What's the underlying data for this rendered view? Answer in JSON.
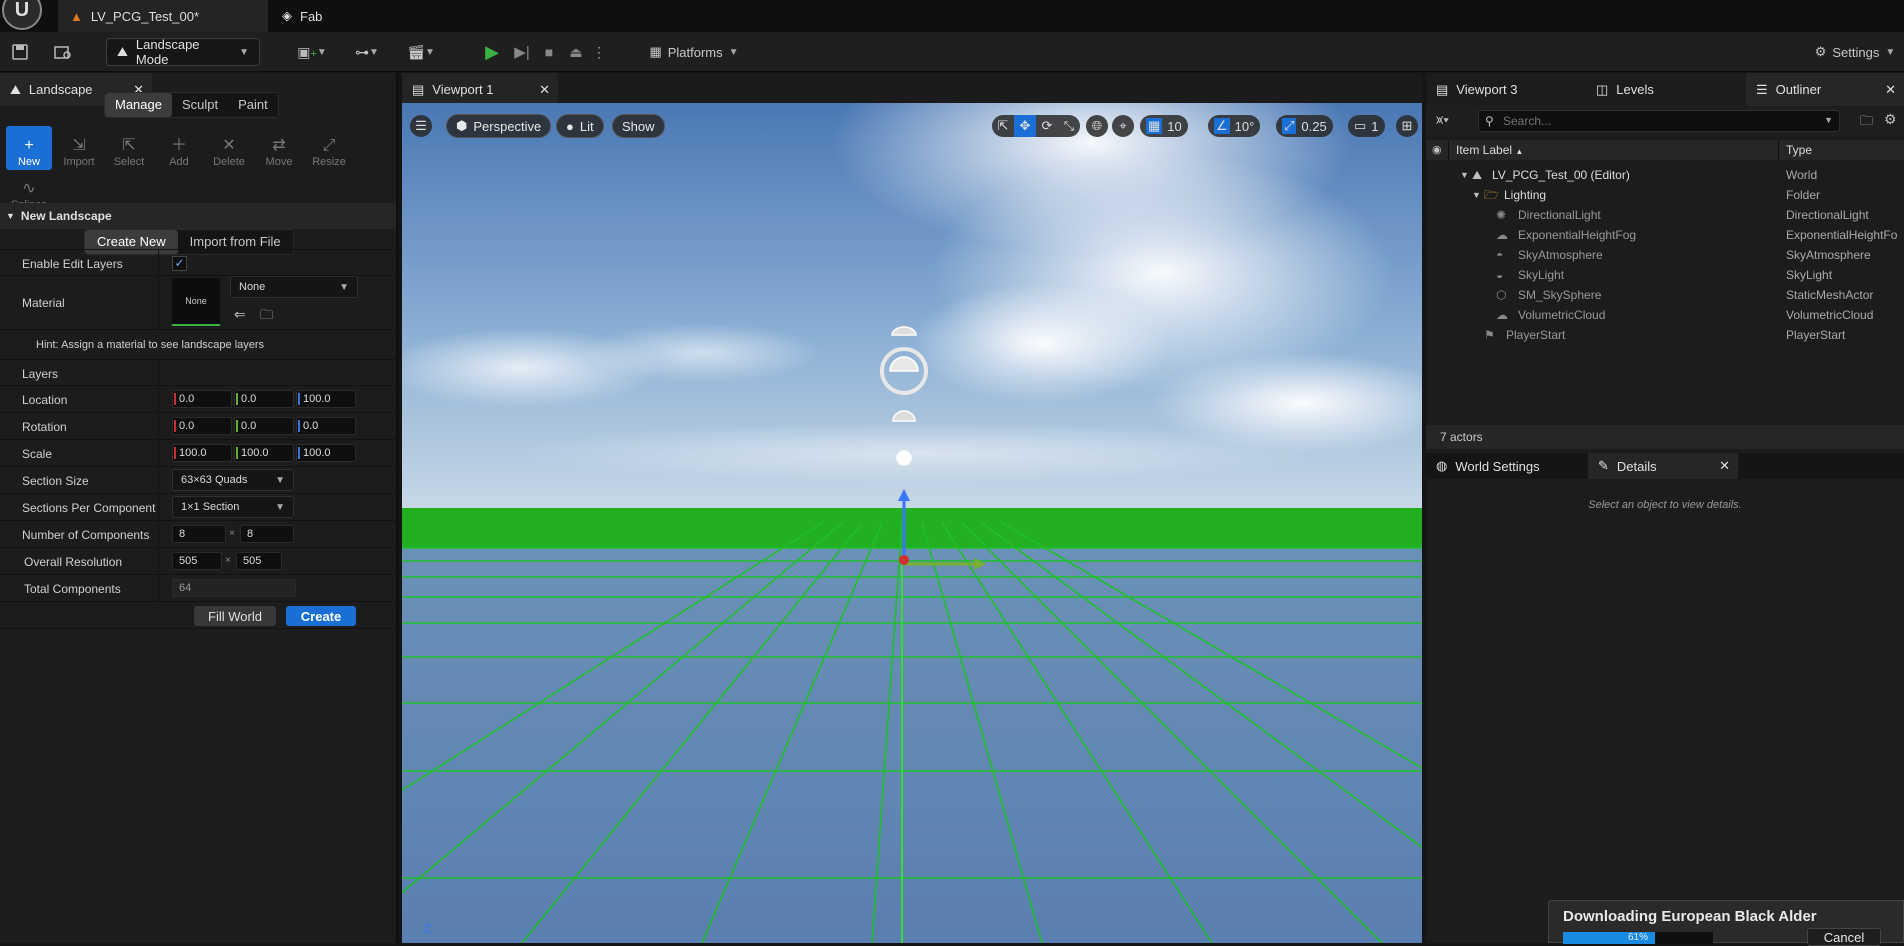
{
  "tabs": [
    {
      "label": "LV_PCG_Test_00*",
      "icon": "level-icon"
    },
    {
      "label": "Fab",
      "icon": "fab-icon"
    }
  ],
  "toolbar": {
    "mode_label": "Landscape Mode",
    "platforms_label": "Platforms",
    "settings_label": "Settings"
  },
  "landscape_panel": {
    "tab_label": "Landscape",
    "modes": [
      "Manage",
      "Sculpt",
      "Paint"
    ],
    "active_mode": "Manage",
    "tools": [
      "New",
      "Import",
      "Select",
      "Add",
      "Delete",
      "Move",
      "Resize",
      "Splines"
    ],
    "active_tool": "New",
    "section_title": "New Landscape",
    "source_tabs": [
      "Create New",
      "Import from File"
    ],
    "enable_edit_layers_label": "Enable Edit Layers",
    "enable_edit_layers_checked": true,
    "material_label": "Material",
    "material_thumb": "None",
    "material_value": "None",
    "hint": "Hint: Assign a material to see landscape layers",
    "layers_label": "Layers",
    "location_label": "Location",
    "location": [
      "0.0",
      "0.0",
      "100.0"
    ],
    "rotation_label": "Rotation",
    "rotation": [
      "0.0",
      "0.0",
      "0.0"
    ],
    "scale_label": "Scale",
    "scale": [
      "100.0",
      "100.0",
      "100.0"
    ],
    "section_size_label": "Section Size",
    "section_size": "63×63 Quads",
    "sections_per_component_label": "Sections Per Component",
    "sections_per_component": "1×1 Section",
    "num_components_label": "Number of Components",
    "num_components": [
      "8",
      "8"
    ],
    "overall_resolution_label": "Overall Resolution",
    "overall_resolution": [
      "505",
      "505"
    ],
    "total_components_label": "Total Components",
    "total_components": "64",
    "fill_world_label": "Fill World",
    "create_label": "Create",
    "times": "×"
  },
  "viewport": {
    "tab_label": "Viewport 1",
    "perspective": "Perspective",
    "lit": "Lit",
    "show": "Show",
    "grid_snap": "10",
    "rotation_snap": "10°",
    "scale_snap": "0.25",
    "camera_speed": "1",
    "axis_label": "Z"
  },
  "right_tabs": [
    "Viewport 3",
    "Levels",
    "Outliner"
  ],
  "outliner": {
    "search_placeholder": "Search...",
    "col_label": "Item Label",
    "col_type": "Type",
    "items": [
      {
        "name": "LV_PCG_Test_00 (Editor)",
        "type": "World"
      },
      {
        "name": "Lighting",
        "type": "Folder"
      },
      {
        "name": "DirectionalLight",
        "type": "DirectionalLight"
      },
      {
        "name": "ExponentialHeightFog",
        "type": "ExponentialHeightFo"
      },
      {
        "name": "SkyAtmosphere",
        "type": "SkyAtmosphere"
      },
      {
        "name": "SkyLight",
        "type": "SkyLight"
      },
      {
        "name": "SM_SkySphere",
        "type": "StaticMeshActor"
      },
      {
        "name": "VolumetricCloud",
        "type": "VolumetricCloud"
      },
      {
        "name": "PlayerStart",
        "type": "PlayerStart"
      }
    ],
    "actor_count": "7 actors"
  },
  "details": {
    "world_settings_label": "World Settings",
    "details_label": "Details",
    "empty_text": "Select an object to view details."
  },
  "download": {
    "title": "Downloading European Black Alder",
    "progress_label": "61%",
    "progress": 0.61,
    "cancel_label": "Cancel"
  },
  "colors": {
    "accent": "#1a6fd6",
    "ground_green": "#22b022",
    "sky_top": "#4a78b4"
  }
}
